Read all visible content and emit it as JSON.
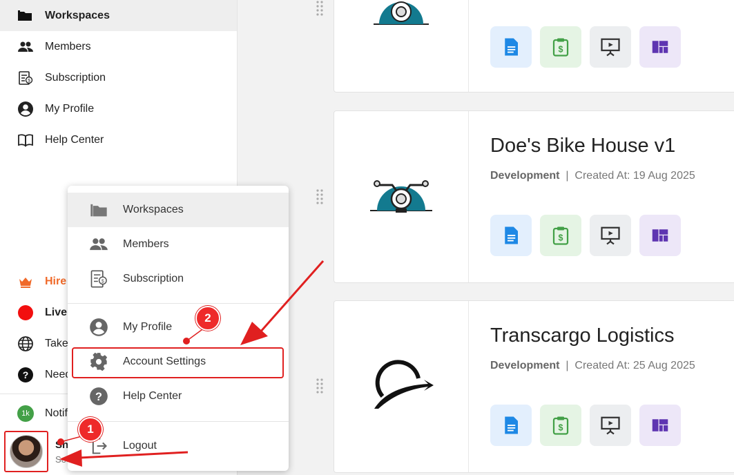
{
  "sidebar": {
    "nav": [
      {
        "label": "Workspaces",
        "icon": "folder-icon"
      },
      {
        "label": "Members",
        "icon": "people-icon"
      },
      {
        "label": "Subscription",
        "icon": "subscription-icon"
      },
      {
        "label": "My Profile",
        "icon": "account-circle-icon"
      },
      {
        "label": "Help Center",
        "icon": "book-icon"
      }
    ],
    "lower": {
      "hire": "Hire",
      "live": "Live",
      "take": "Take",
      "need": "Need",
      "notifications": "Notifi",
      "notif_badge": "1k"
    },
    "user": {
      "name": "Sh",
      "sub": "Se"
    }
  },
  "cards": [
    {
      "title": "",
      "meta_category": "",
      "meta_created": ""
    },
    {
      "title": "Doe's Bike House v1",
      "meta_category": "Development",
      "meta_created": "Created At: 19 Aug 2025"
    },
    {
      "title": "Transcargo Logistics",
      "meta_category": "Development",
      "meta_created": "Created At: 25 Aug 2025"
    }
  ],
  "meta_separator": "|",
  "menu": {
    "items": [
      {
        "label": "Workspaces",
        "icon": "folder-icon"
      },
      {
        "label": "Members",
        "icon": "people-icon"
      },
      {
        "label": "Subscription",
        "icon": "subscription-icon"
      },
      {
        "label": "My Profile",
        "icon": "account-circle-icon"
      },
      {
        "label": "Account Settings",
        "icon": "gear-icon"
      },
      {
        "label": "Help Center",
        "icon": "help-icon"
      },
      {
        "label": "Logout",
        "icon": "logout-icon"
      }
    ]
  },
  "annotations": {
    "step1": "1",
    "step2": "2"
  },
  "colors": {
    "accent_red": "#e02020",
    "hire_orange": "#f06a2a",
    "doc_blue": "#1e88e5",
    "invoice_green": "#43a047",
    "dash_purple": "#5e35b1"
  }
}
